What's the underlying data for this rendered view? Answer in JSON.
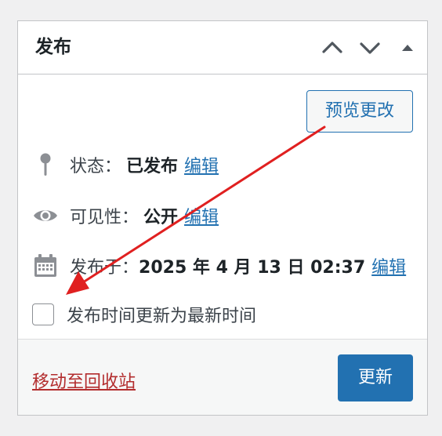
{
  "panel": {
    "title": "发布",
    "header_buttons": [
      {
        "name": "move-up",
        "icon": "chevron-up-icon"
      },
      {
        "name": "move-down",
        "icon": "chevron-down-icon"
      },
      {
        "name": "toggle",
        "icon": "triangle-up-icon"
      }
    ]
  },
  "preview_button": {
    "label": "预览更改"
  },
  "status": {
    "icon": "pin-icon",
    "label": "状态：",
    "value": "已发布",
    "edit_label": "编辑"
  },
  "visibility": {
    "icon": "eye-icon",
    "label": "可见性：",
    "value": "公开",
    "edit_label": "编辑"
  },
  "publish_date": {
    "icon": "calendar-icon",
    "label": "发布于：",
    "value": "2025 年 4 月 13 日 02:37",
    "edit_label": "编辑"
  },
  "checkbox": {
    "label": "发布时间更新为最新时间",
    "checked": false
  },
  "footer": {
    "trash_label": "移动至回收站",
    "update_label": "更新"
  },
  "colors": {
    "accent": "#2271b1",
    "danger": "#b32d2e",
    "text": "#1d2327",
    "annotation_arrow": "#e02020"
  }
}
